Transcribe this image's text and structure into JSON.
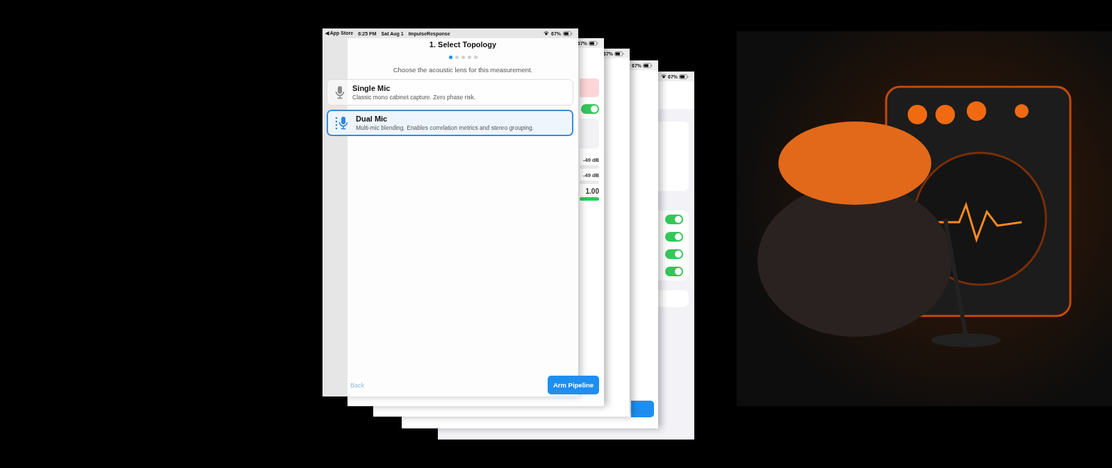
{
  "front_screen": {
    "status_bar": {
      "back_link": "◀ App Store",
      "time": "6:25 PM",
      "date": "Sat Aug 1",
      "app_name": "ImpulseResponse",
      "battery": "67%"
    },
    "title": "1. Select Topology",
    "page_dots": [
      {
        "selected": true
      },
      {
        "selected": false
      },
      {
        "selected": false
      },
      {
        "selected": false
      },
      {
        "selected": false
      }
    ],
    "subtitle": "Choose the acoustic lens for this measurement.",
    "options": [
      {
        "kind": "single",
        "title": "Single Mic",
        "description": "Classic mono cabinet capture. Zero phase risk.",
        "selected": false
      },
      {
        "kind": "dual",
        "title": "Dual Mic",
        "description": "Multi-mic blending. Enables correlation metrics and stereo grouping.",
        "selected": true
      }
    ],
    "back_button": "Back",
    "primary_button": "Arm Pipeline"
  },
  "back_screens": [
    {
      "kind": "phase_gain",
      "battery": "67%",
      "toggle_on": true,
      "meters": [
        {
          "reading": "-49 dB"
        },
        {
          "reading": "-49 dB"
        }
      ],
      "correlation": {
        "reading": "1.00",
        "level": 1.0
      }
    },
    {
      "kind": "blank",
      "battery": "67%"
    },
    {
      "kind": "reamp",
      "battery": "67%"
    },
    {
      "kind": "settings",
      "battery": "67%",
      "toggles": [
        {
          "on": true
        },
        {
          "on": true
        },
        {
          "on": true
        },
        {
          "on": true
        }
      ]
    }
  ]
}
